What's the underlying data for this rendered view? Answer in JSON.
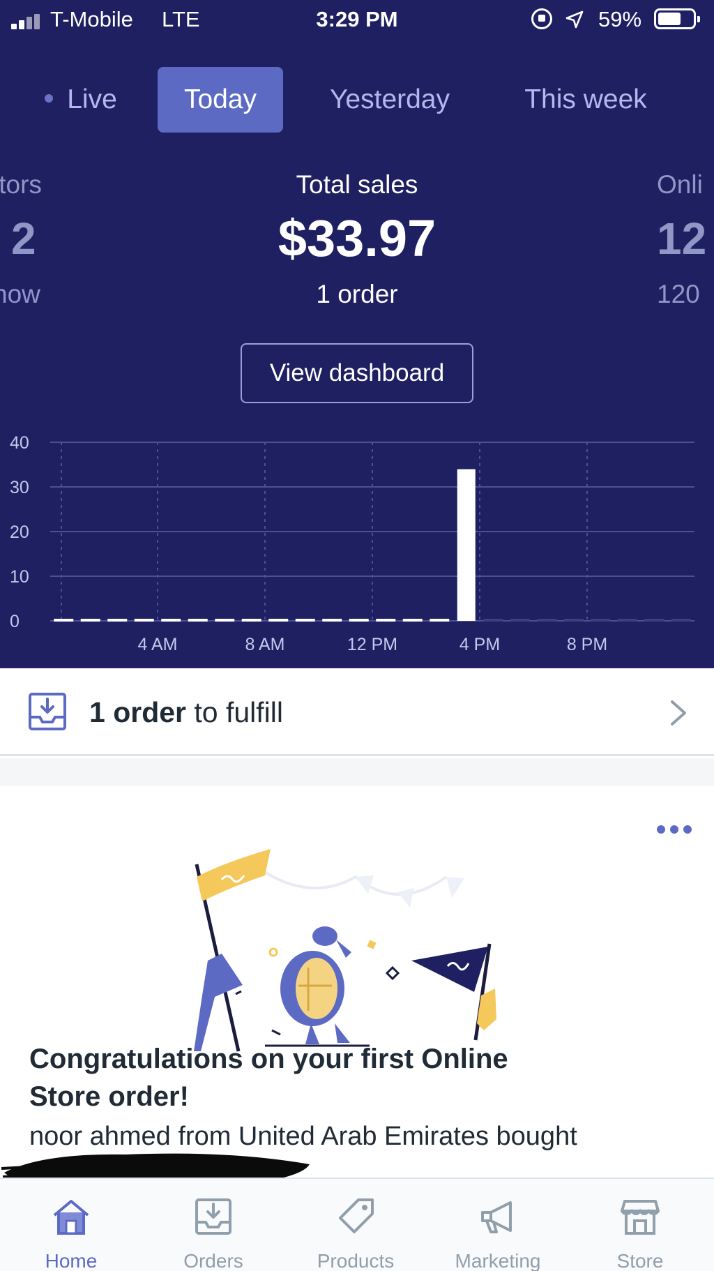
{
  "status_bar": {
    "carrier": "T-Mobile",
    "network": "LTE",
    "time": "3:29 PM",
    "battery": "59%",
    "battery_level": 0.59
  },
  "tabs": [
    {
      "label": "Live",
      "active": false
    },
    {
      "label": "Today",
      "active": true
    },
    {
      "label": "Yesterday",
      "active": false
    },
    {
      "label": "This week",
      "active": false
    }
  ],
  "metrics": {
    "left": {
      "label": "itors",
      "value": "2",
      "sub": "now"
    },
    "center": {
      "label": "Total sales",
      "value": "$33.97",
      "sub": "1 order"
    },
    "right": {
      "label": "Onli",
      "value": "12",
      "sub": "120"
    }
  },
  "view_dashboard_label": "View dashboard",
  "chart_data": {
    "type": "bar",
    "categories": [
      "12 AM",
      "1 AM",
      "2 AM",
      "3 AM",
      "4 AM",
      "5 AM",
      "6 AM",
      "7 AM",
      "8 AM",
      "9 AM",
      "10 AM",
      "11 AM",
      "12 PM",
      "1 PM",
      "2 PM",
      "3 PM",
      "4 PM",
      "5 PM",
      "6 PM",
      "7 PM",
      "8 PM",
      "9 PM",
      "10 PM",
      "11 PM"
    ],
    "values": [
      0,
      0,
      0,
      0,
      0,
      0,
      0,
      0,
      0,
      0,
      0,
      0,
      0,
      0,
      0,
      33.97,
      0,
      0,
      0,
      0,
      0,
      0,
      0,
      0
    ],
    "x_tick_labels": [
      "4 AM",
      "8 AM",
      "12 PM",
      "4 PM",
      "8 PM"
    ],
    "y_ticks": [
      0,
      10,
      20,
      30,
      40
    ],
    "ylim": [
      0,
      40
    ],
    "grid": true,
    "colors": {
      "bar": "#ffffff",
      "grid": "#4b4f99",
      "future": "#3b3f84"
    }
  },
  "fulfill": {
    "count_label": "1 order",
    "suffix": " to fulfill"
  },
  "card": {
    "title": "Congratulations on your first Online Store order!",
    "body": "noor ahmed from United Arab Emirates bought"
  },
  "nav": [
    {
      "label": "Home",
      "icon": "home-icon",
      "active": true
    },
    {
      "label": "Orders",
      "icon": "orders-icon",
      "active": false
    },
    {
      "label": "Products",
      "icon": "tag-icon",
      "active": false
    },
    {
      "label": "Marketing",
      "icon": "megaphone-icon",
      "active": false
    },
    {
      "label": "Store",
      "icon": "store-icon",
      "active": false
    }
  ],
  "colors": {
    "header_bg": "#1f2061",
    "accent": "#5c6ac4",
    "text": "#212b36",
    "muted": "#919eab"
  }
}
